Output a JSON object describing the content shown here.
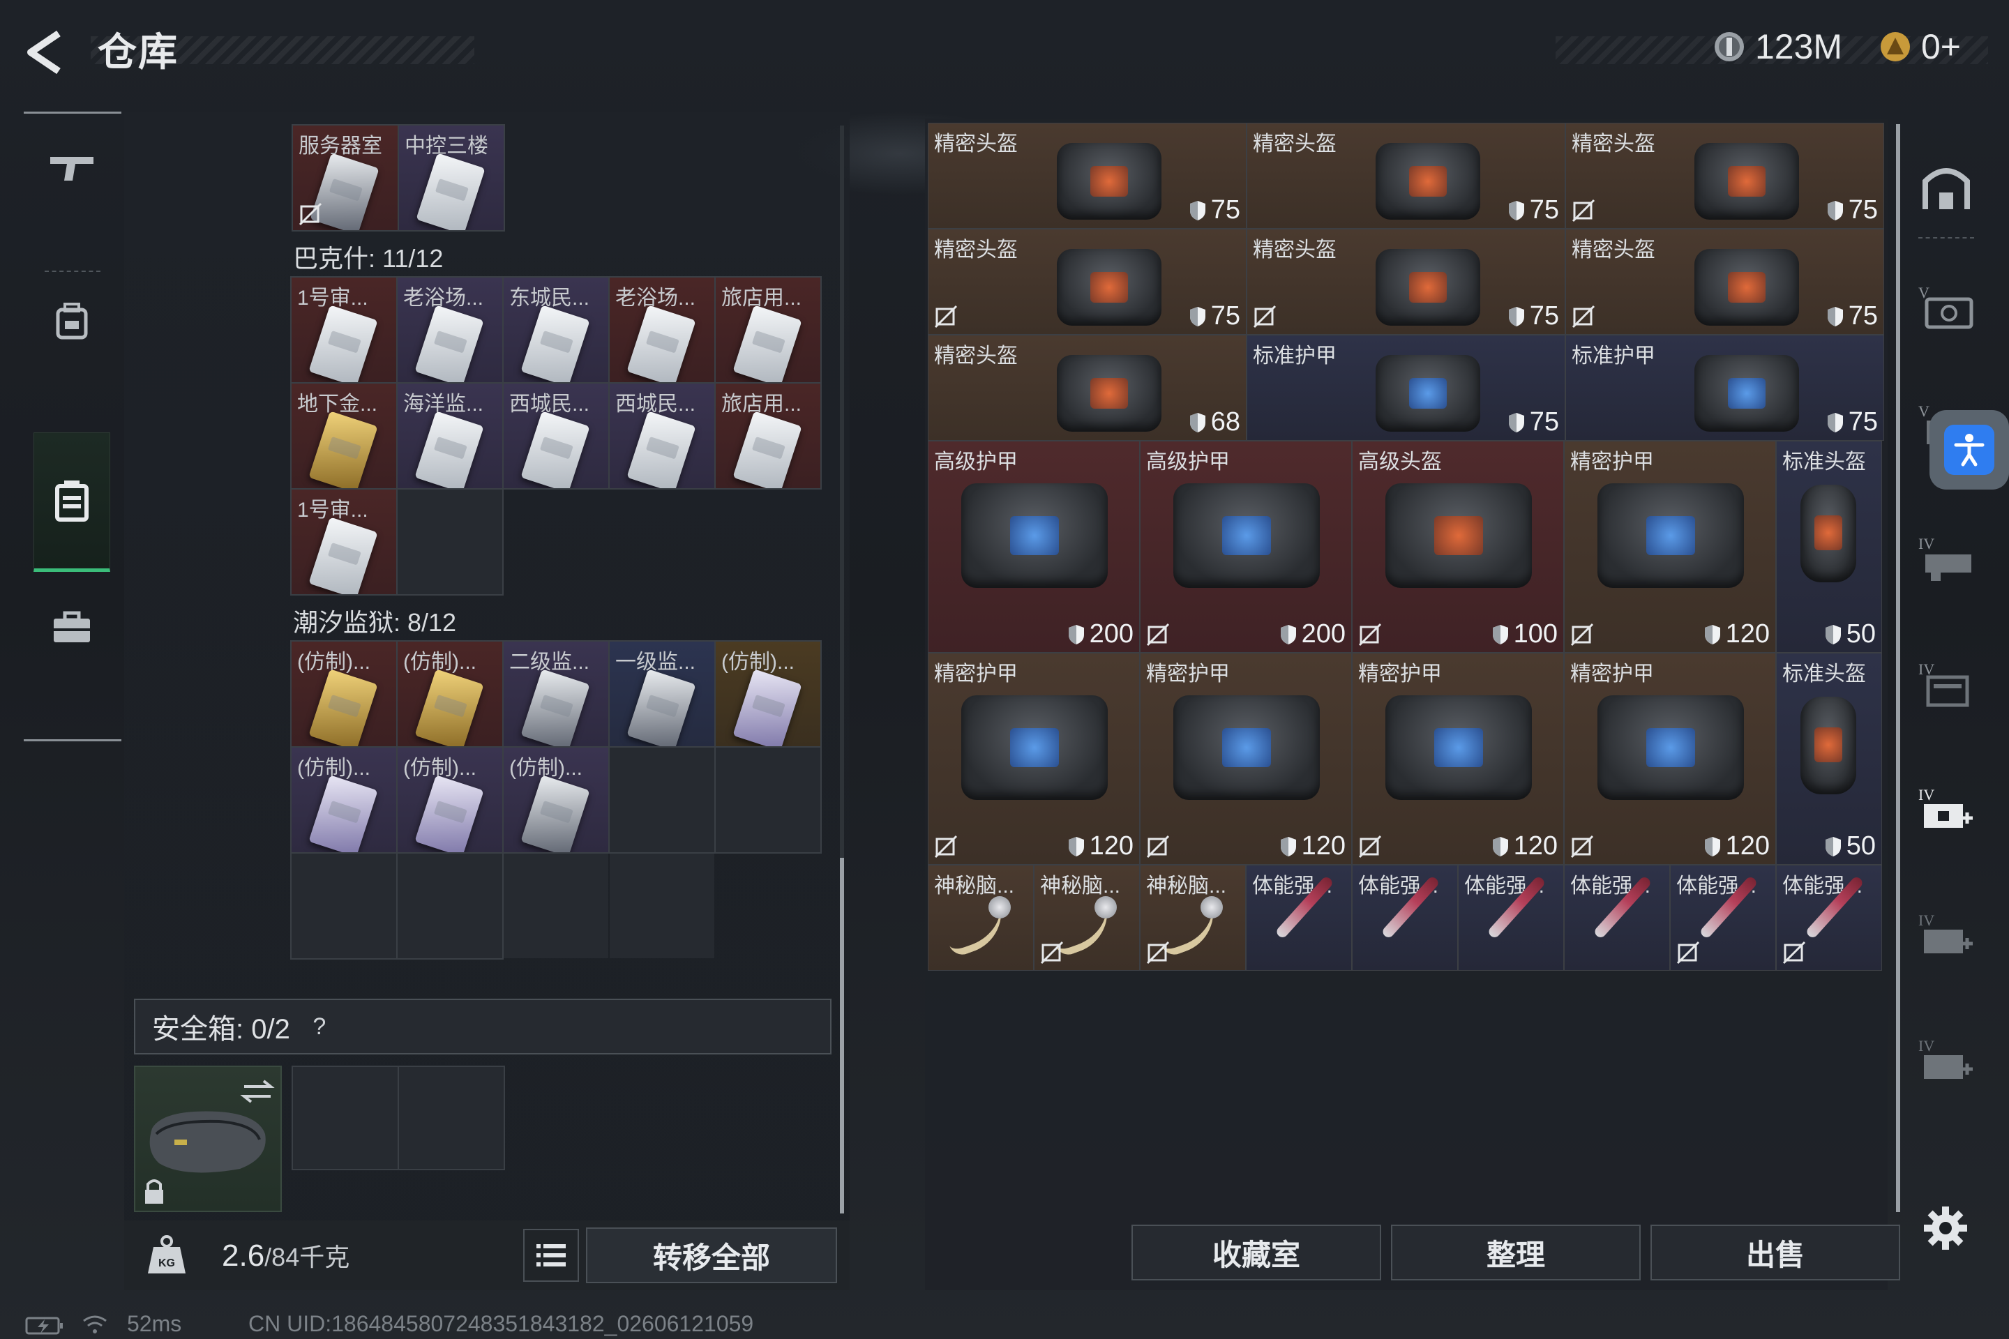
{
  "header": {
    "title": "仓库",
    "money": "123M",
    "tokens": "0+"
  },
  "left_sidebar": {
    "items": [
      {
        "name": "weapon-tab",
        "icon": "gun-icon"
      },
      {
        "name": "backpack-tab",
        "icon": "backpack-icon"
      },
      {
        "name": "keycard-tab",
        "icon": "keycard-case-icon",
        "active": true
      },
      {
        "name": "briefcase-tab",
        "icon": "briefcase-icon"
      }
    ]
  },
  "top_partial_row": [
    {
      "label": "服务器室",
      "nosell": true
    },
    {
      "label": "中控三楼",
      "nosell": false
    }
  ],
  "bakesh": {
    "title": "巴克什: 11/12",
    "cells": [
      {
        "label": "1号审...",
        "tone": "red",
        "card": "white"
      },
      {
        "label": "老浴场...",
        "tone": "purple",
        "card": "white"
      },
      {
        "label": "东城民...",
        "tone": "purple",
        "card": "white"
      },
      {
        "label": "老浴场...",
        "tone": "red",
        "card": "white"
      },
      {
        "label": "旅店用...",
        "tone": "red",
        "card": "white"
      },
      {
        "label": "地下金...",
        "tone": "red",
        "card": "gold"
      },
      {
        "label": "海洋监...",
        "tone": "purple",
        "card": "white"
      },
      {
        "label": "西城民...",
        "tone": "purple",
        "card": "white"
      },
      {
        "label": "西城民...",
        "tone": "purple",
        "card": "white"
      },
      {
        "label": "旅店用...",
        "tone": "red",
        "card": "white"
      },
      {
        "label": "1号审...",
        "tone": "red",
        "card": "white"
      }
    ]
  },
  "tide_prison": {
    "title": "潮汐监狱: 8/12",
    "cells": [
      {
        "label": "(仿制)...",
        "tone": "red",
        "card": "gold"
      },
      {
        "label": "(仿制)...",
        "tone": "red",
        "card": "gold"
      },
      {
        "label": "二级监...",
        "tone": "purple",
        "card": "dark"
      },
      {
        "label": "一级监...",
        "tone": "blue",
        "card": "dark"
      },
      {
        "label": "(仿制)...",
        "tone": "gold",
        "card": "purple"
      },
      {
        "label": "(仿制)...",
        "tone": "purple",
        "card": "purple"
      },
      {
        "label": "(仿制)...",
        "tone": "purple",
        "card": "purple"
      },
      {
        "label": "(仿制)...",
        "tone": "purple",
        "card": "dark"
      }
    ]
  },
  "safe_box": {
    "label": "安全箱: 0/2",
    "help": "?"
  },
  "bottom_left": {
    "weight": "2.6",
    "weight_max": "/84千克",
    "transfer_all": "转移全部"
  },
  "stash": {
    "small_rows": [
      [
        {
          "label": "精密头盔",
          "durability": "75",
          "tone": "brown",
          "plate": "red",
          "nosell": false
        },
        {
          "label": "精密头盔",
          "durability": "75",
          "tone": "brown",
          "plate": "red",
          "nosell": false
        },
        {
          "label": "精密头盔",
          "durability": "75",
          "tone": "brown",
          "plate": "red",
          "nosell": true
        }
      ],
      [
        {
          "label": "精密头盔",
          "durability": "75",
          "tone": "brown",
          "plate": "red",
          "nosell": true
        },
        {
          "label": "精密头盔",
          "durability": "75",
          "tone": "brown",
          "plate": "red",
          "nosell": true
        },
        {
          "label": "精密头盔",
          "durability": "75",
          "tone": "brown",
          "plate": "red",
          "nosell": true
        }
      ],
      [
        {
          "label": "精密头盔",
          "durability": "68",
          "tone": "brown",
          "plate": "red",
          "nosell": false
        },
        {
          "label": "标准护甲",
          "durability": "75",
          "tone": "navy",
          "plate": "blue",
          "nosell": false
        },
        {
          "label": "标准护甲",
          "durability": "75",
          "tone": "navy",
          "plate": "blue",
          "nosell": false
        }
      ]
    ],
    "large_rows": [
      [
        {
          "label": "高级护甲",
          "durability": "200",
          "tone": "maroon",
          "plate": "blue",
          "nosell": false
        },
        {
          "label": "高级护甲",
          "durability": "200",
          "tone": "maroon",
          "plate": "blue",
          "nosell": true
        },
        {
          "label": "高级头盔",
          "durability": "100",
          "tone": "maroon",
          "plate": "red",
          "nosell": true
        },
        {
          "label": "精密护甲",
          "durability": "120",
          "tone": "brown",
          "plate": "blue",
          "nosell": true
        },
        {
          "label": "标准头盔",
          "durability": "50",
          "tone": "navy",
          "plate": "red",
          "nosell": false,
          "narrow": true
        }
      ],
      [
        {
          "label": "精密护甲",
          "durability": "120",
          "tone": "brown",
          "plate": "blue",
          "nosell": true
        },
        {
          "label": "精密护甲",
          "durability": "120",
          "tone": "brown",
          "plate": "blue",
          "nosell": true
        },
        {
          "label": "精密护甲",
          "durability": "120",
          "tone": "brown",
          "plate": "blue",
          "nosell": true
        },
        {
          "label": "精密护甲",
          "durability": "120",
          "tone": "brown",
          "plate": "blue",
          "nosell": true
        },
        {
          "label": "标准头盔",
          "durability": "50",
          "tone": "navy",
          "plate": "red",
          "nosell": false,
          "narrow": true
        }
      ]
    ],
    "consumables": [
      {
        "label": "神秘脑...",
        "kind": "neuro",
        "tone": "brown",
        "nosell": false
      },
      {
        "label": "神秘脑...",
        "kind": "neuro",
        "tone": "brown",
        "nosell": true
      },
      {
        "label": "神秘脑...",
        "kind": "neuro",
        "tone": "brown",
        "nosell": true
      },
      {
        "label": "体能强...",
        "kind": "syringe",
        "tone": "navy",
        "nosell": false
      },
      {
        "label": "体能强...",
        "kind": "syringe",
        "tone": "navy",
        "nosell": false
      },
      {
        "label": "体能强...",
        "kind": "syringe",
        "tone": "navy",
        "nosell": false
      },
      {
        "label": "体能强...",
        "kind": "syringe",
        "tone": "navy",
        "nosell": false
      },
      {
        "label": "体能强...",
        "kind": "syringe",
        "tone": "navy",
        "nosell": true
      },
      {
        "label": "体能强...",
        "kind": "syringe",
        "tone": "navy",
        "nosell": true
      }
    ]
  },
  "right_sidebar": {
    "items": [
      "vault-icon",
      "stash-page-1-icon",
      "stash-page-2-icon",
      "stash-page-3-icon",
      "stash-page-4-icon",
      "add-stash-page-icon",
      "add-stash-page-locked-icon",
      "add-stash-page-locked-icon-2"
    ]
  },
  "bottom_right": {
    "collection": "收藏室",
    "sort": "整理",
    "sell": "出售"
  },
  "status_bar": {
    "ping": "52ms",
    "uid": "CN UID:1864845807248351843182_02606121059"
  },
  "colors": {
    "accent_green": "#3bbd7a",
    "tone_red": "#4a2626",
    "tone_purple": "#3a3450",
    "tone_brown": "#4a3a2f",
    "accessibility_blue": "#2f7df0"
  }
}
